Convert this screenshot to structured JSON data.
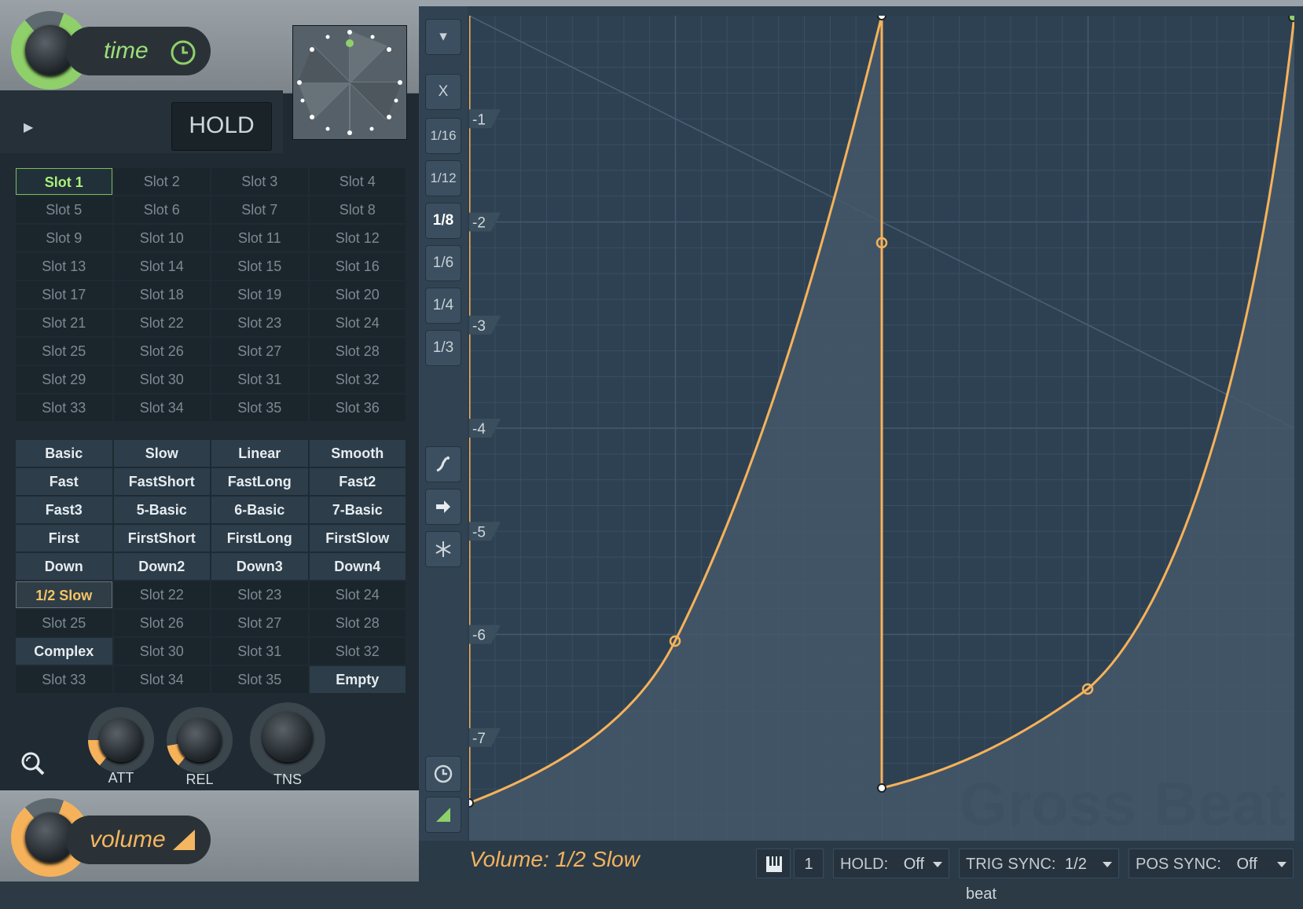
{
  "time_header": {
    "label": "time",
    "icon": "clock-icon",
    "knob_color": "#8fd06a"
  },
  "hold_button": "HOLD",
  "time_slots": [
    "Slot 1",
    "Slot 2",
    "Slot 3",
    "Slot 4",
    "Slot 5",
    "Slot 6",
    "Slot 7",
    "Slot 8",
    "Slot 9",
    "Slot 10",
    "Slot 11",
    "Slot 12",
    "Slot 13",
    "Slot 14",
    "Slot 15",
    "Slot 16",
    "Slot 17",
    "Slot 18",
    "Slot 19",
    "Slot 20",
    "Slot 21",
    "Slot 22",
    "Slot 23",
    "Slot 24",
    "Slot 25",
    "Slot 26",
    "Slot 27",
    "Slot 28",
    "Slot 29",
    "Slot 30",
    "Slot 31",
    "Slot 32",
    "Slot 33",
    "Slot 34",
    "Slot 35",
    "Slot 36"
  ],
  "time_selected": 0,
  "volume_slots": [
    "Basic",
    "Slow",
    "Linear",
    "Smooth",
    "Fast",
    "FastShort",
    "FastLong",
    "Fast2",
    "Fast3",
    "5-Basic",
    "6-Basic",
    "7-Basic",
    "First",
    "FirstShort",
    "FirstLong",
    "FirstSlow",
    "Down",
    "Down2",
    "Down3",
    "Down4",
    "1/2 Slow",
    "Slot 22",
    "Slot 23",
    "Slot 24",
    "Slot 25",
    "Slot 26",
    "Slot 27",
    "Slot 28",
    "Complex",
    "Slot 30",
    "Slot 31",
    "Slot 32",
    "Slot 33",
    "Slot 34",
    "Slot 35",
    "Empty"
  ],
  "volume_named": [
    0,
    1,
    2,
    3,
    4,
    5,
    6,
    7,
    8,
    9,
    10,
    11,
    12,
    13,
    14,
    15,
    16,
    17,
    18,
    19,
    28,
    35
  ],
  "volume_selected": 20,
  "knobs": [
    {
      "label": "ATT"
    },
    {
      "label": "REL"
    },
    {
      "label": "TNS"
    }
  ],
  "volume_header": {
    "label": "volume",
    "knob_color": "#f6b25a"
  },
  "tools": {
    "dropdown": "▾",
    "x": "X",
    "grid": [
      "1/16",
      "1/12",
      "1/8",
      "1/6",
      "1/4",
      "1/3"
    ],
    "grid_active": "1/8"
  },
  "y_labels": [
    "-1",
    "-2",
    "-3",
    "-4",
    "-5",
    "-6",
    "-7"
  ],
  "watermark": "Gross Beat",
  "status": "Volume: 1/2 Slow",
  "footer": {
    "piano_icon": "piano-icon",
    "channel": "1",
    "hold_label": "HOLD:",
    "hold_value": "Off",
    "trig_label": "TRIG SYNC:",
    "trig_value": "1/2 beat",
    "pos_label": "POS SYNC:",
    "pos_value": "Off"
  },
  "colors": {
    "curve": "#f6b25a",
    "accent_green": "#8fd06a",
    "grid_bg": "#2c3d4c"
  }
}
